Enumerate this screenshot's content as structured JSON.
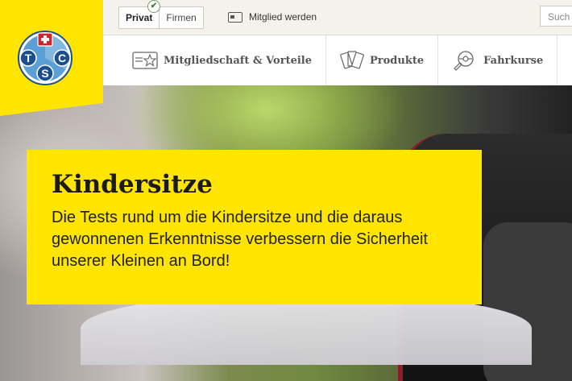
{
  "topbar": {
    "segments": {
      "private_label": "Privat",
      "business_label": "Firmen"
    },
    "member_link": "Mitglied werden",
    "search_placeholder": "Such"
  },
  "nav": {
    "items": [
      {
        "label": "Mitgliedschaft & Vorteile",
        "icon": "membership-card-icon"
      },
      {
        "label": "Produkte",
        "icon": "product-cards-icon"
      },
      {
        "label": "Fahrkurse",
        "icon": "driving-course-icon"
      }
    ]
  },
  "logo": {
    "letters": [
      "T",
      "C",
      "S"
    ],
    "colors": {
      "blue": "#1d4f8f",
      "red": "#d2232a",
      "light_blue": "#5aa0d6"
    }
  },
  "hero": {
    "title": "Kindersitze",
    "text": "Die Tests rund um die Kindersitze und die daraus gewonnenen Erkenntnisse verbessern die Sicherheit unserer Kleinen an Bord!"
  },
  "colors": {
    "accent_yellow": "#ffe500"
  }
}
